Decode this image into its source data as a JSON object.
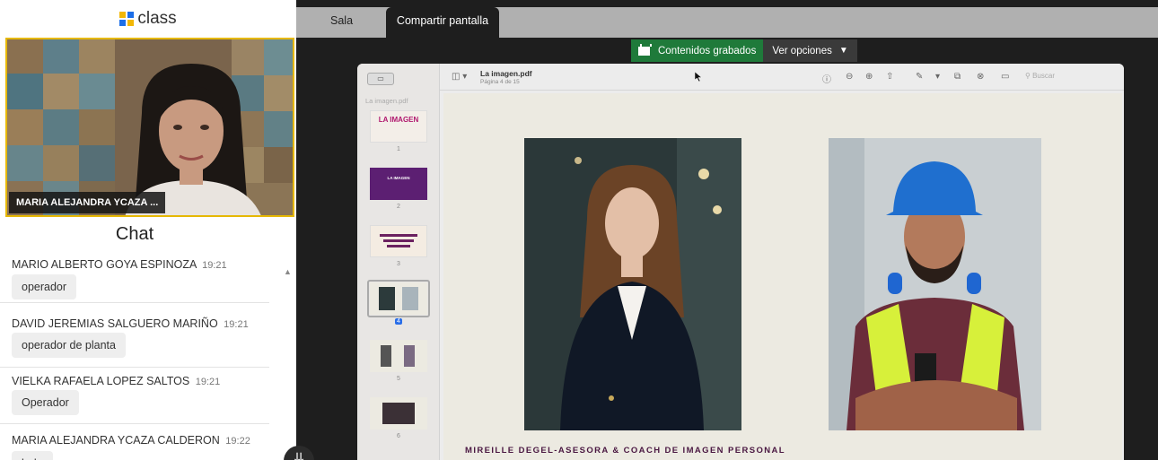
{
  "app": {
    "logo_text": "class",
    "logo_colors": [
      "#f2b705",
      "#1c6ee8",
      "#1c6ee8",
      "#f2b705"
    ]
  },
  "video": {
    "participant_name": "MARIA ALEJANDRA YCAZA ..."
  },
  "chat": {
    "title": "Chat",
    "messages": [
      {
        "author": "MARIO ALBERTO GOYA ESPINOZA",
        "time": "19:21",
        "text": "operador"
      },
      {
        "author": "DAVID JEREMIAS SALGUERO MARIÑO",
        "time": "19:21",
        "text": "operador de planta"
      },
      {
        "author": "VIELKA RAFAELA LOPEZ SALTOS",
        "time": "19:21",
        "text": "Operador"
      },
      {
        "author": "MARIA ALEJANDRA YCAZA CALDERON",
        "time": "19:22",
        "text": "hola"
      }
    ]
  },
  "tabs": [
    {
      "label": "Sala"
    },
    {
      "label": "Compartir pantalla"
    }
  ],
  "recording": {
    "label": "Contenidos grabados",
    "options_label": "Ver opciones",
    "color": "#1f7a3a"
  },
  "pdf": {
    "sidebar_file": "La imagen.pdf",
    "file_name": "La imagen.pdf",
    "page_info": "Página 4 de 15",
    "search_placeholder": "Buscar",
    "thumbnails": [
      {
        "page": "1",
        "title": "LA IMAGEN"
      },
      {
        "page": "2",
        "title": "LA IMAGEN"
      },
      {
        "page": "3"
      },
      {
        "page": "4",
        "selected": true
      },
      {
        "page": "5"
      },
      {
        "page": "6"
      }
    ],
    "caption": "MIREILLE DEGEL-ASESORA & COACH DE IMAGEN PERSONAL",
    "accent": "#4a1842"
  }
}
